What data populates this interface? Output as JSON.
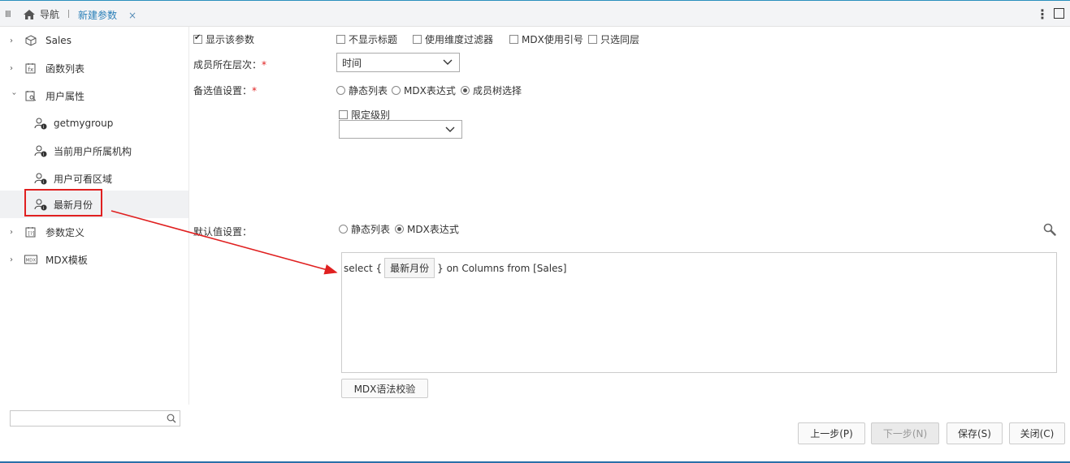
{
  "topbar": {
    "menu_glyph": "III",
    "home_label": "导航",
    "active_tab_label": "新建参数",
    "close_glyph": "×",
    "more_glyph": "⋮"
  },
  "tree": {
    "items": [
      {
        "label": "Sales",
        "icon": "cube-icon",
        "expanded": false
      },
      {
        "label": "函数列表",
        "icon": "function-list-icon",
        "expanded": false
      },
      {
        "label": "用户属性",
        "icon": "user-attribute-icon",
        "expanded": true
      },
      {
        "label": "getmygroup",
        "icon": "user-info-icon"
      },
      {
        "label": "当前用户所属机构",
        "icon": "user-info-icon"
      },
      {
        "label": "用户可看区域",
        "icon": "user-info-icon"
      },
      {
        "label": "最新月份",
        "icon": "user-info-icon",
        "selected": true
      },
      {
        "label": "参数定义",
        "icon": "param-definition-icon",
        "expanded": false
      },
      {
        "label": "MDX模板",
        "icon": "mdx-template-icon",
        "expanded": false
      }
    ],
    "search_value": ""
  },
  "form": {
    "show_param_label": "显示该参数",
    "show_param_checked": true,
    "options": {
      "hide_title": "不显示标题",
      "use_dimension_filter": "使用维度过滤器",
      "mdx_use_quotes": "MDX使用引号",
      "only_same_level": "只选同层"
    },
    "member_level_label": "成员所在层次：",
    "member_level_value": "时间",
    "candidate_label": "备选值设置：",
    "candidate_options": [
      "静态列表",
      "MDX表达式",
      "成员树选择"
    ],
    "candidate_selected": "成员树选择",
    "limit_level_label": "限定级别",
    "limit_level_value": "",
    "default_label": "默认值设置：",
    "default_options": [
      "静态列表",
      "MDX表达式"
    ],
    "default_selected": "MDX表达式",
    "mdx_prefix": "select {",
    "mdx_token": "最新月份",
    "mdx_suffix": "} on Columns from [Sales]",
    "mdx_check_button": "MDX语法校验",
    "required_mark": "*"
  },
  "footer": {
    "prev": "上一步(P)",
    "next": "下一步(N)",
    "save": "保存(S)",
    "close": "关闭(C)"
  },
  "colors": {
    "accent": "#2a7fb8",
    "annotation_red": "#e02020"
  }
}
